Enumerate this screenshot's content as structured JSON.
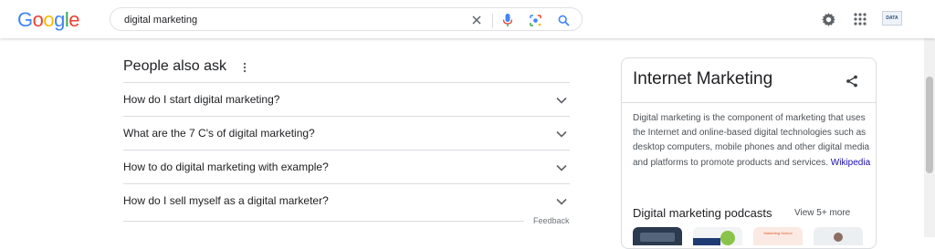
{
  "header": {
    "logo_letters": [
      {
        "char": "G",
        "color": "#4285F4"
      },
      {
        "char": "o",
        "color": "#EA4335"
      },
      {
        "char": "o",
        "color": "#FBBC05"
      },
      {
        "char": "g",
        "color": "#4285F4"
      },
      {
        "char": "l",
        "color": "#34A853"
      },
      {
        "char": "e",
        "color": "#EA4335"
      }
    ],
    "search": {
      "value": "digital marketing",
      "icons": [
        "close-icon",
        "microphone-icon",
        "lens-icon",
        "search-icon"
      ]
    },
    "right_icons": [
      "gear-icon",
      "apps-grid-icon",
      "account-avatar"
    ],
    "avatar_text": "DATA"
  },
  "paa": {
    "title": "People also ask",
    "questions": [
      "How do I start digital marketing?",
      "What are the 7 C's of digital marketing?",
      "How to do digital marketing with example?",
      "How do I sell myself as a digital marketer?"
    ],
    "feedback_label": "Feedback"
  },
  "knowledge_panel": {
    "title": "Internet Marketing",
    "description": "Digital marketing is the component of marketing that uses the Internet and online-based digital technologies such as desktop computers, mobile phones and other digital media and platforms to promote products and services.",
    "source_link": "Wikipedia",
    "podcasts_heading": "Digital marketing podcasts",
    "view_more": "View 5+ more",
    "thumb_text": "Marketing School"
  },
  "colors": {
    "link": "#1a0dab",
    "mic": "#4285F4",
    "lens": "#4285F4",
    "search": "#4285F4"
  }
}
